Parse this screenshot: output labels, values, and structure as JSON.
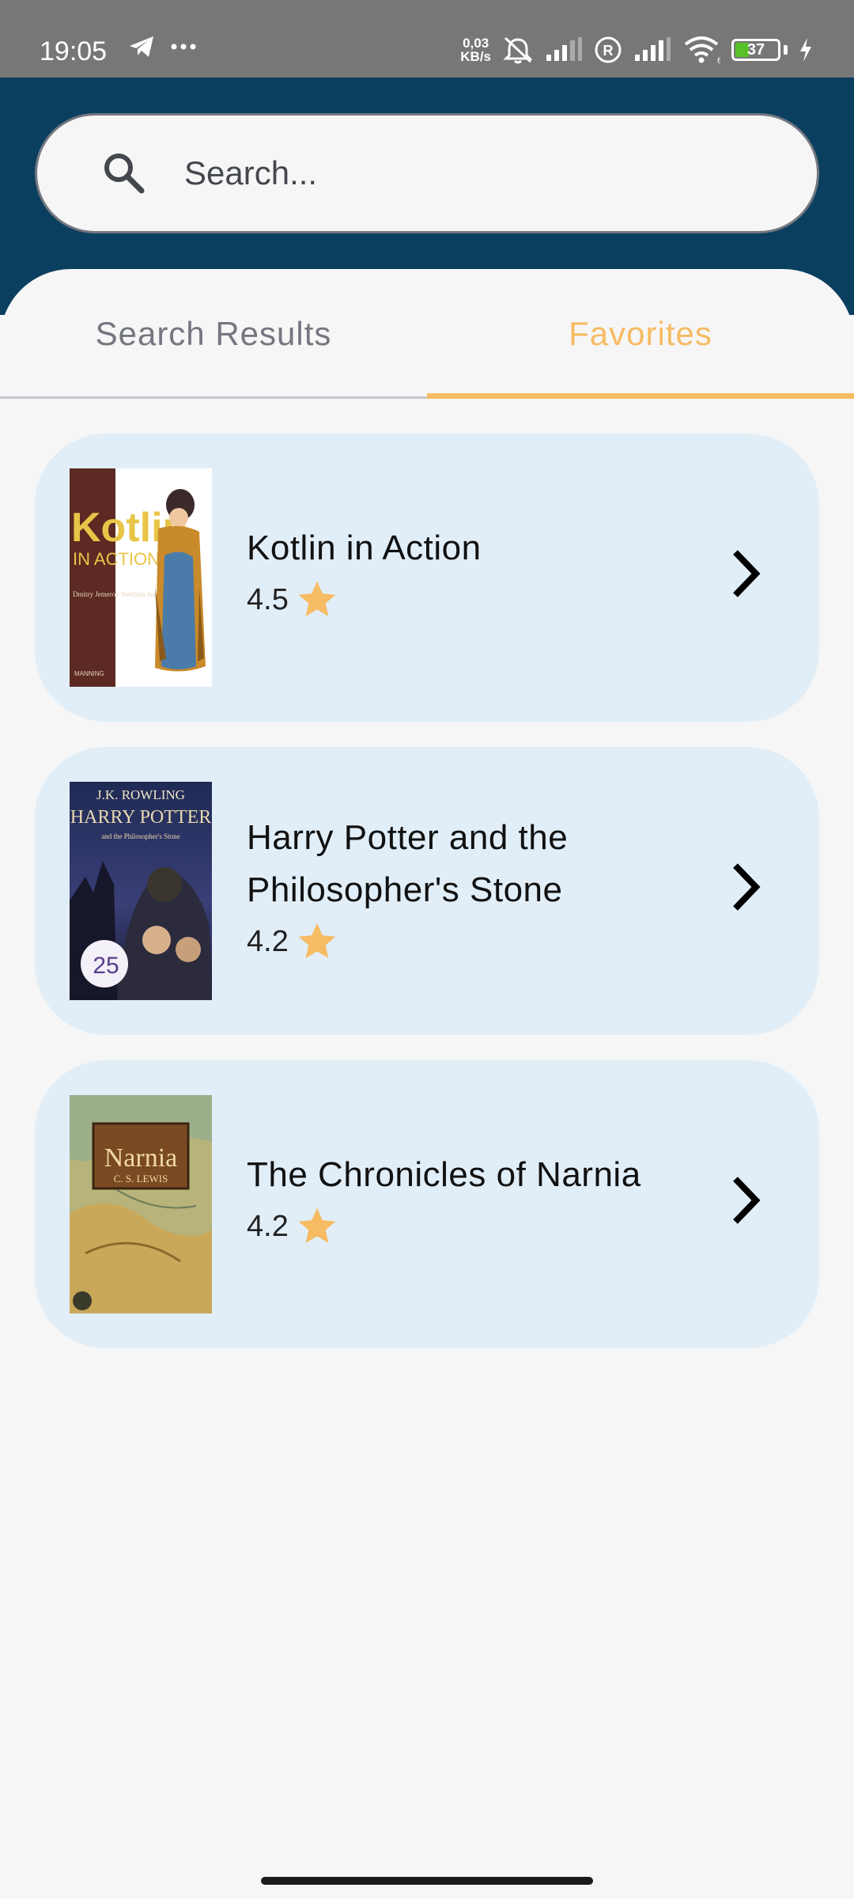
{
  "status_bar": {
    "time": "19:05",
    "net_speed_value": "0,03",
    "net_speed_unit": "KB/s",
    "battery_level": "37",
    "battery_fraction": 0.37,
    "icons": [
      "telegram-icon",
      "more-dots-icon",
      "alarm-off-icon",
      "signal-icon",
      "roaming-icon",
      "signal-icon",
      "wifi-icon",
      "battery-icon",
      "charging-icon"
    ]
  },
  "search": {
    "placeholder": "Search...",
    "value": ""
  },
  "tabs": [
    {
      "label": "Search Results",
      "selected": false
    },
    {
      "label": "Favorites",
      "selected": true
    }
  ],
  "colors": {
    "header": "#0b3f5f",
    "accent": "#f7bb63",
    "card": "#e1eef8"
  },
  "books": [
    {
      "title": "Kotlin in Action",
      "rating": "4.5",
      "cover_text": {
        "title": "Kotlin",
        "subtitle": "IN ACTION",
        "authors": "Dmitry Jemerov Svetlana Isakova",
        "publisher": "MANNING"
      }
    },
    {
      "title": "Harry Potter and the Philosopher's Stone",
      "rating": "4.2",
      "cover_text": {
        "author": "J.K. ROWLING",
        "title": "HARRY POTTER",
        "subtitle": "and the Philosopher's Stone",
        "badge": "25"
      }
    },
    {
      "title": "The Chronicles of Narnia",
      "rating": "4.2",
      "cover_text": {
        "title": "Narnia",
        "author": "C. S. LEWIS"
      }
    }
  ]
}
